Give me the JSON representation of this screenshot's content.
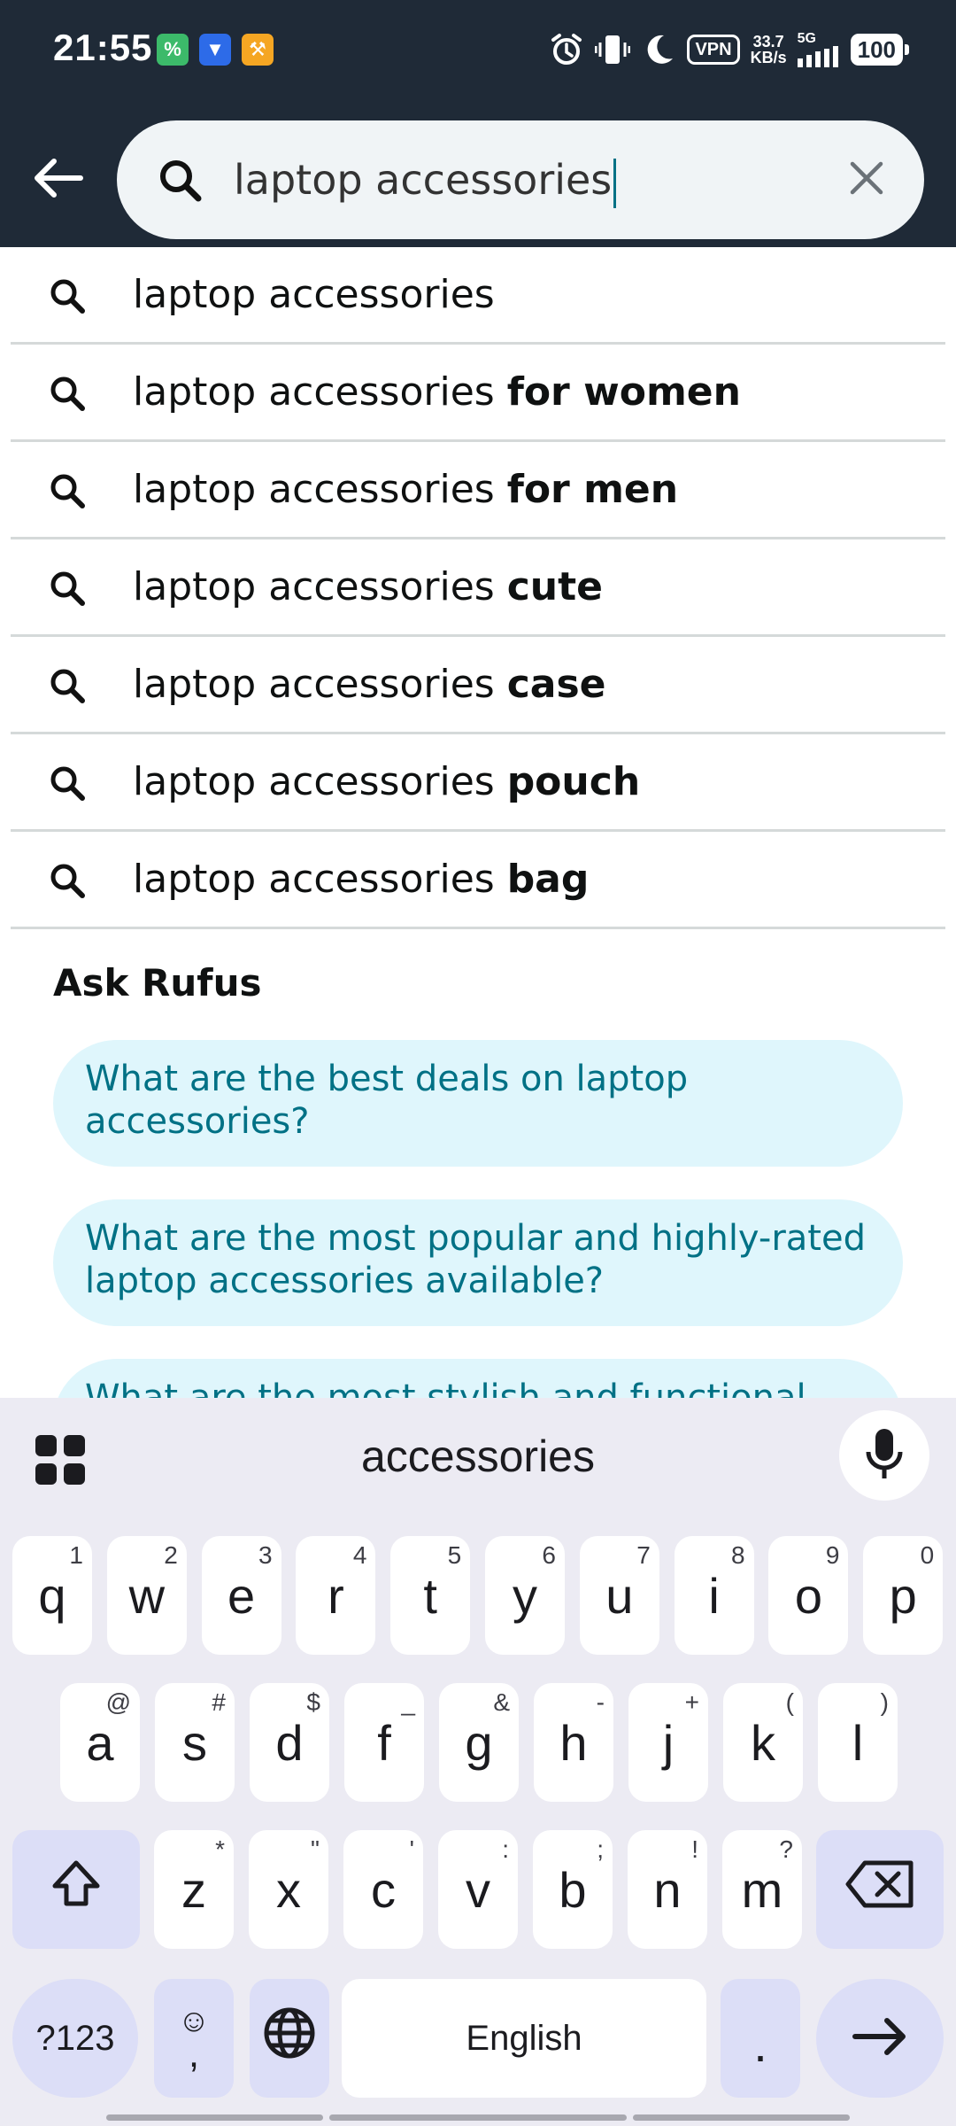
{
  "status_bar": {
    "time": "21:55",
    "app_badges": [
      {
        "name": "percent-app-icon",
        "glyph": "%",
        "color": "green"
      },
      {
        "name": "shirt-app-icon",
        "glyph": "▼",
        "color": "blue"
      },
      {
        "name": "tools-app-icon",
        "glyph": "⚒",
        "color": "orange"
      }
    ],
    "vpn": "VPN",
    "net_speed_value": "33.7",
    "net_speed_unit": "KB/s",
    "network": "5G",
    "battery": "100"
  },
  "search": {
    "query": "laptop accessories",
    "icons": {
      "back": "back-arrow-icon",
      "search": "search-icon",
      "clear": "close-icon"
    }
  },
  "suggestions": [
    {
      "prefix": "laptop accessories",
      "suffix": ""
    },
    {
      "prefix": "laptop accessories ",
      "suffix": "for women"
    },
    {
      "prefix": "laptop accessories ",
      "suffix": "for men"
    },
    {
      "prefix": "laptop accessories ",
      "suffix": "cute"
    },
    {
      "prefix": "laptop accessories ",
      "suffix": "case"
    },
    {
      "prefix": "laptop accessories ",
      "suffix": "pouch"
    },
    {
      "prefix": "laptop accessories ",
      "suffix": "bag"
    }
  ],
  "rufus": {
    "title": "Ask Rufus",
    "chips": [
      "What are the best deals on laptop accessories?",
      "What are the most popular and highly-rated laptop accessories available?",
      "What are the most stylish and functional"
    ]
  },
  "keyboard": {
    "prediction": "accessories",
    "row1": [
      {
        "key": "q",
        "hint": "1"
      },
      {
        "key": "w",
        "hint": "2"
      },
      {
        "key": "e",
        "hint": "3"
      },
      {
        "key": "r",
        "hint": "4"
      },
      {
        "key": "t",
        "hint": "5"
      },
      {
        "key": "y",
        "hint": "6"
      },
      {
        "key": "u",
        "hint": "7"
      },
      {
        "key": "i",
        "hint": "8"
      },
      {
        "key": "o",
        "hint": "9"
      },
      {
        "key": "p",
        "hint": "0"
      }
    ],
    "row2": [
      {
        "key": "a",
        "hint": "@"
      },
      {
        "key": "s",
        "hint": "#"
      },
      {
        "key": "d",
        "hint": "$"
      },
      {
        "key": "f",
        "hint": "_"
      },
      {
        "key": "g",
        "hint": "&"
      },
      {
        "key": "h",
        "hint": "-"
      },
      {
        "key": "j",
        "hint": "+"
      },
      {
        "key": "k",
        "hint": "("
      },
      {
        "key": "l",
        "hint": ")"
      }
    ],
    "row3": [
      {
        "key": "z",
        "hint": "*"
      },
      {
        "key": "x",
        "hint": "\""
      },
      {
        "key": "c",
        "hint": "'"
      },
      {
        "key": "v",
        "hint": ":"
      },
      {
        "key": "b",
        "hint": ";"
      },
      {
        "key": "n",
        "hint": "!"
      },
      {
        "key": "m",
        "hint": "?"
      }
    ],
    "symbols_label": "?123",
    "emoji_glyph": "☺",
    "comma_label": ",",
    "space_label": "English",
    "period_label": ".",
    "icons": {
      "apps": "apps-grid-icon",
      "mic": "microphone-icon",
      "shift": "shift-icon",
      "backspace": "backspace-icon",
      "globe": "globe-icon",
      "enter": "enter-arrow-icon"
    }
  },
  "colors": {
    "header_bg": "#1f2a37",
    "chip_bg": "#dff6fc",
    "chip_text": "#007185",
    "keyboard_bg": "#ecebf3",
    "modifier_key_bg": "#dcdef7"
  }
}
